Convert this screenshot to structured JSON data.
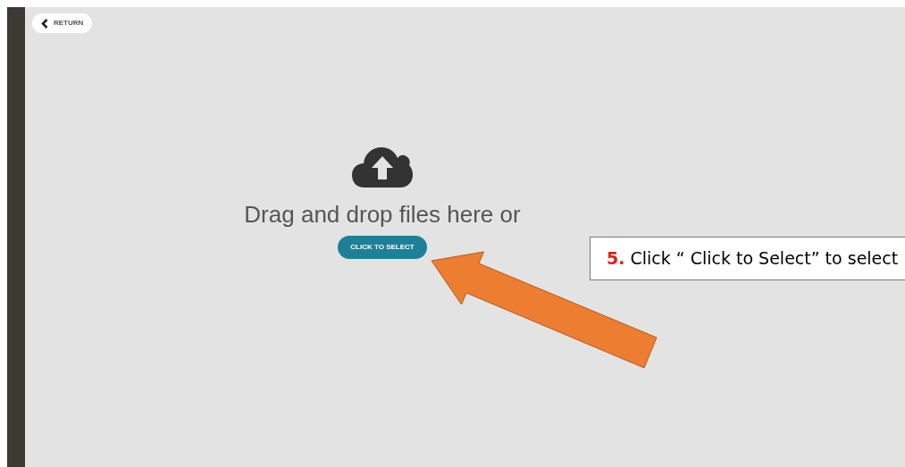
{
  "return_button": {
    "label": "RETURN"
  },
  "dropzone": {
    "prompt": "Drag and drop files here or",
    "button": "CLICK TO SELECT"
  },
  "callout": {
    "number": "5.",
    "text": "Click “ Click to Select” to select"
  }
}
